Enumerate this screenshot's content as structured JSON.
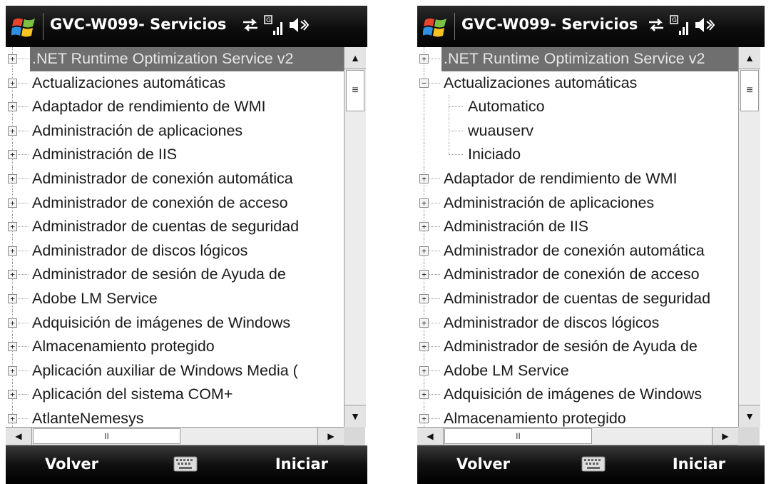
{
  "left": {
    "title": "GVC-W099- Servicios",
    "rows": [
      {
        "label": ".NET Runtime Optimization Service v2",
        "expander": "+",
        "selected": true
      },
      {
        "label": "Actualizaciones automáticas",
        "expander": "+"
      },
      {
        "label": "Adaptador de rendimiento de WMI",
        "expander": "+"
      },
      {
        "label": "Administración de aplicaciones",
        "expander": "+"
      },
      {
        "label": "Administración de IIS",
        "expander": "+"
      },
      {
        "label": "Administrador de conexión automática",
        "expander": "+"
      },
      {
        "label": "Administrador de conexión de acceso",
        "expander": "+"
      },
      {
        "label": "Administrador de cuentas de seguridad",
        "expander": "+"
      },
      {
        "label": "Administrador de discos lógicos",
        "expander": "+"
      },
      {
        "label": "Administrador de sesión de Ayuda de",
        "expander": "+"
      },
      {
        "label": "Adobe LM Service",
        "expander": "+"
      },
      {
        "label": "Adquisición de imágenes de Windows",
        "expander": "+"
      },
      {
        "label": "Almacenamiento protegido",
        "expander": "+"
      },
      {
        "label": "Aplicación auxiliar de Windows Media (",
        "expander": "+"
      },
      {
        "label": "Aplicación del sistema COM+",
        "expander": "+"
      },
      {
        "label": "AtlanteNemesys",
        "expander": "+"
      }
    ],
    "scroll": {
      "up": "▲",
      "down": "▼",
      "left": "◀",
      "right": "▶",
      "grip": "≡",
      "hgrip": "II"
    },
    "softkeys": {
      "left": "Volver",
      "right": "Iniciar"
    }
  },
  "right": {
    "title": "GVC-W099- Servicios",
    "rows": [
      {
        "label": ".NET Runtime Optimization Service v2",
        "expander": "+",
        "selected": true
      },
      {
        "label": "Actualizaciones automáticas",
        "expander": "−"
      },
      {
        "label": "Automatico",
        "child": true
      },
      {
        "label": "wuauserv",
        "child": true
      },
      {
        "label": "Iniciado",
        "child": true,
        "last": true
      },
      {
        "label": "Adaptador de rendimiento de WMI",
        "expander": "+"
      },
      {
        "label": "Administración de aplicaciones",
        "expander": "+"
      },
      {
        "label": "Administración de IIS",
        "expander": "+"
      },
      {
        "label": "Administrador de conexión automática",
        "expander": "+"
      },
      {
        "label": "Administrador de conexión de acceso",
        "expander": "+"
      },
      {
        "label": "Administrador de cuentas de seguridad",
        "expander": "+"
      },
      {
        "label": "Administrador de discos lógicos",
        "expander": "+"
      },
      {
        "label": "Administrador de sesión de Ayuda de",
        "expander": "+"
      },
      {
        "label": "Adobe LM Service",
        "expander": "+"
      },
      {
        "label": "Adquisición de imágenes de Windows",
        "expander": "+"
      },
      {
        "label": "Almacenamiento protegido",
        "expander": "+"
      }
    ],
    "scroll": {
      "up": "▲",
      "down": "▼",
      "left": "◀",
      "right": "▶",
      "grip": "≡",
      "hgrip": "II"
    },
    "softkeys": {
      "left": "Volver",
      "right": "Iniciar"
    }
  },
  "icons": [
    "windows-logo-icon",
    "sync-icon",
    "signal-icon",
    "volume-muted-icon",
    "keyboard-icon"
  ],
  "colors": {
    "titlebar": "#0d0d0d",
    "selection": "#6f6f6f",
    "scrollbar": "#ececec"
  }
}
